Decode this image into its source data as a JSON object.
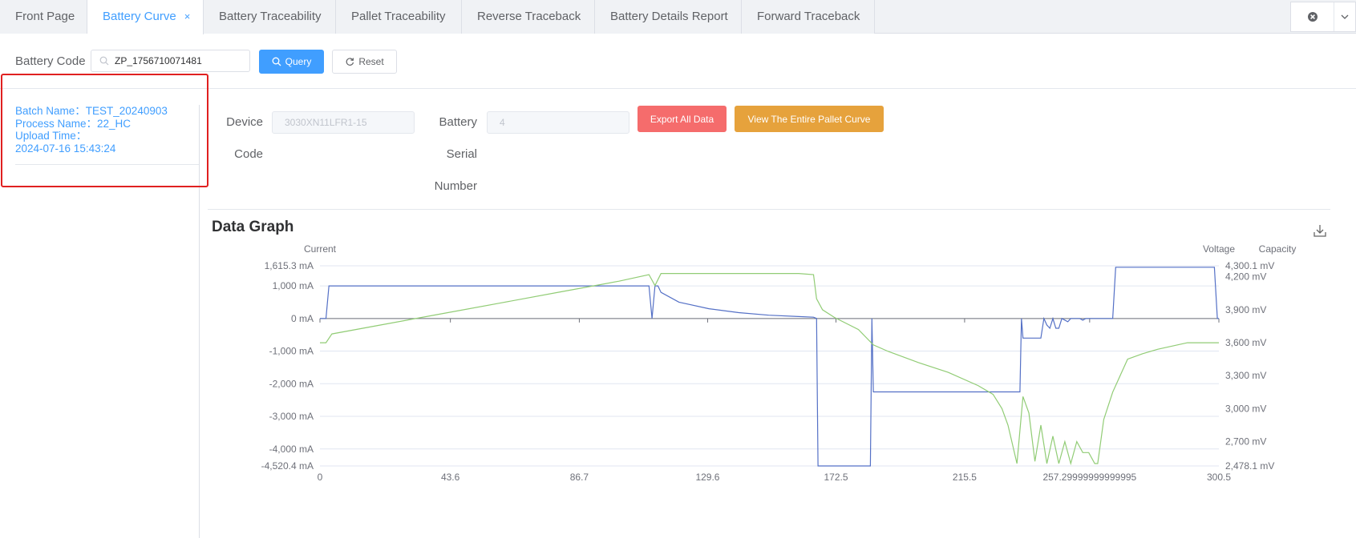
{
  "tabs": [
    {
      "label": "Front Page",
      "active": false
    },
    {
      "label": "Battery Curve",
      "active": true,
      "closable": true
    },
    {
      "label": "Battery Traceability",
      "active": false
    },
    {
      "label": "Pallet Traceability",
      "active": false
    },
    {
      "label": "Reverse Traceback",
      "active": false
    },
    {
      "label": "Battery Details Report",
      "active": false
    },
    {
      "label": "Forward Traceback",
      "active": false
    }
  ],
  "query": {
    "battery_code_label": "Battery Code",
    "battery_code_value": "ZP_1756710071481",
    "query_label": "Query",
    "reset_label": "Reset"
  },
  "batch": {
    "batch_name": "Batch Name：TEST_20240903",
    "process_name": "Process Name：22_HC",
    "upload_time_label": "Upload Time：",
    "upload_time": "2024-07-16 15:43:24"
  },
  "form": {
    "device_code_label_1": "Device",
    "device_code_label_2": "Code",
    "device_code_value": "3030XN11LFR1-15",
    "battery_serial_label_1": "Battery",
    "battery_serial_label_2": "Serial",
    "battery_serial_label_3": "Number",
    "battery_serial_value": "4",
    "export_label": "Export All Data",
    "view_pallet_label": "View The Entire Pallet Curve"
  },
  "graph": {
    "title": "Data Graph"
  },
  "colors": {
    "current": "#5470c6",
    "voltage": "#91cc75",
    "primary": "#409eff",
    "danger": "#f56c6c",
    "warning": "#e6a23c",
    "highlight_box": "#e02020"
  },
  "chart_data": {
    "type": "line",
    "title": "Data Graph",
    "legend_axis_names": {
      "left": "Current",
      "right_1": "Voltage",
      "right_2": "Capacity"
    },
    "x_ticks": [
      "0",
      "43.6",
      "86.7",
      "129.6",
      "172.5",
      "215.5",
      "257.29999999999995",
      "300.5"
    ],
    "xlim": [
      0,
      300.5
    ],
    "y_left_ticks": [
      "1,615.3 mA",
      "1,000 mA",
      "0 mA",
      "-1,000 mA",
      "-2,000 mA",
      "-3,000 mA",
      "-4,000 mA",
      "-4,520.4 mA"
    ],
    "y_left_range": [
      -4520.4,
      1615.3
    ],
    "y_right_ticks": [
      "4,300.1 mV",
      "4,200 mV",
      "3,900 mV",
      "3,600 mV",
      "3,300 mV",
      "3,000 mV",
      "2,700 mV",
      "2,478.1 mV"
    ],
    "y_right_range": [
      2478.1,
      4300.1
    ],
    "series": [
      {
        "name": "Current",
        "axis": "left",
        "x": [
          0,
          2,
          3,
          110,
          111,
          112,
          113,
          114,
          120,
          130,
          140,
          150,
          160,
          165,
          166,
          166.5,
          167,
          184,
          184.5,
          185,
          234,
          234.5,
          235,
          236,
          241,
          242,
          243,
          244,
          245,
          246,
          247,
          248,
          250,
          251,
          254,
          255,
          256,
          257,
          265,
          266,
          299,
          300,
          300.5
        ],
        "values": [
          0,
          0,
          1000,
          1000,
          0,
          1000,
          1000,
          800,
          500,
          300,
          180,
          100,
          60,
          40,
          0,
          -4520,
          -4520,
          -4520,
          0,
          -2250,
          -2250,
          0,
          -600,
          -600,
          -600,
          0,
          -200,
          -300,
          0,
          -300,
          -300,
          0,
          -100,
          0,
          0,
          -50,
          0,
          0,
          0,
          1570,
          1570,
          0,
          0
        ]
      },
      {
        "name": "Voltage",
        "axis": "right",
        "x": [
          0,
          2,
          4,
          20,
          40,
          60,
          80,
          100,
          110,
          112,
          114,
          120,
          140,
          160,
          165,
          166,
          168,
          172,
          180,
          185,
          190,
          200,
          210,
          220,
          225,
          228,
          230,
          233,
          235,
          237,
          239,
          241,
          243,
          245,
          247,
          249,
          251,
          253,
          255,
          257,
          259,
          260,
          262,
          265,
          270,
          275,
          280,
          290,
          298,
          300.5
        ],
        "values": [
          3600,
          3600,
          3680,
          3760,
          3860,
          3960,
          4060,
          4160,
          4220,
          4120,
          4230,
          4230,
          4230,
          4230,
          4220,
          4000,
          3900,
          3830,
          3720,
          3580,
          3520,
          3420,
          3330,
          3210,
          3130,
          3000,
          2850,
          2500,
          3110,
          2960,
          2520,
          2850,
          2500,
          2750,
          2500,
          2700,
          2500,
          2700,
          2600,
          2600,
          2500,
          2500,
          2900,
          3150,
          3450,
          3500,
          3540,
          3600,
          3600,
          3600
        ]
      }
    ],
    "grid": true
  }
}
